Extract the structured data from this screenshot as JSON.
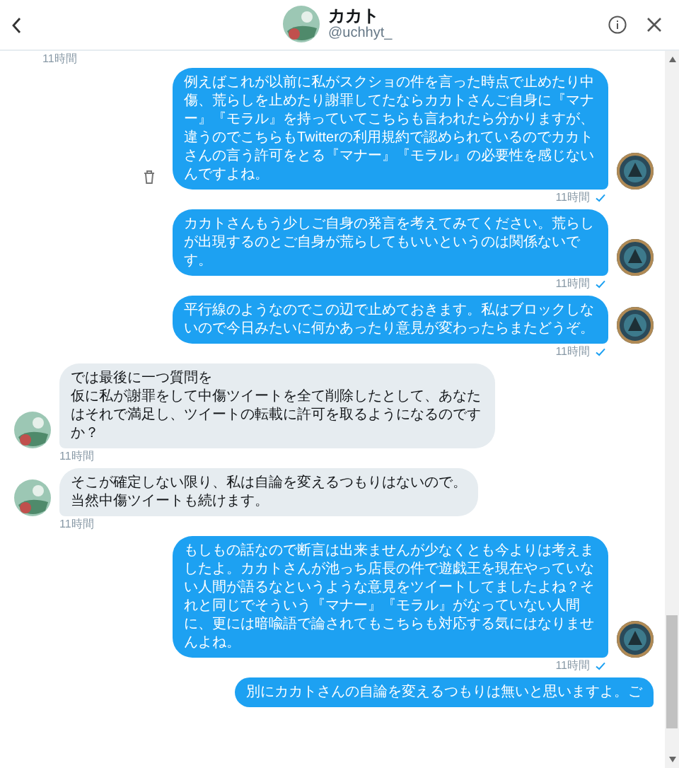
{
  "header": {
    "name": "カカト",
    "handle": "@uchhyt_"
  },
  "top_time": "11時間",
  "messages": [
    {
      "kind": "sent",
      "lines": [
        "例えばこれが以前に私がスクショの件を言った時点で止めたり中傷、荒らしを止めたり謝罪してたならカカトさんご自身に『マナー』『モラル』を持っていてこちらも言われたら分かりますが、違うのでこちらもTwitterの利用規約で認められているのでカカトさんの言う許可をとる『マナー』『モラル』の必要性を感じないんですよね。"
      ],
      "time": "11時間",
      "read": true,
      "hovered": true
    },
    {
      "kind": "sent",
      "lines": [
        "カカトさんもう少しご自身の発言を考えてみてください。荒らしが出現するのとご自身が荒らしてもいいというのは関係ないです。"
      ],
      "time": "11時間",
      "read": true,
      "hovered": false
    },
    {
      "kind": "sent",
      "lines": [
        "平行線のようなのでこの辺で止めておきます。私はブロックしないので今日みたいに何かあったり意見が変わったらまたどうぞ。"
      ],
      "time": "11時間",
      "read": true,
      "hovered": false
    },
    {
      "kind": "received",
      "lines": [
        "では最後に一つ質問を",
        "仮に私が謝罪をして中傷ツイートを全て削除したとして、あなたはそれで満足し、ツイートの転載に許可を取るようになるのですか？"
      ],
      "time": "11時間"
    },
    {
      "kind": "received",
      "lines": [
        "そこが確定しない限り、私は自論を変えるつもりはないので。",
        "当然中傷ツイートも続けます。"
      ],
      "time": "11時間"
    },
    {
      "kind": "sent",
      "lines": [
        "もしもの話なので断言は出来ませんが少なくとも今よりは考えましたよ。カカトさんが池っち店長の件で遊戯王を現在やっていない人間が語るなというような意見をツイートしてましたよね？それと同じでそういう『マナー』『モラル』がなっていない人間に、更には暗喩語で論されてもこちらも対応する気にはなりませんよね。"
      ],
      "time": "11時間",
      "read": true,
      "hovered": false
    },
    {
      "kind": "sent",
      "lines": [
        "別にカカトさんの自論を変えるつもりは無いと思いますよ。ご"
      ]
    }
  ]
}
